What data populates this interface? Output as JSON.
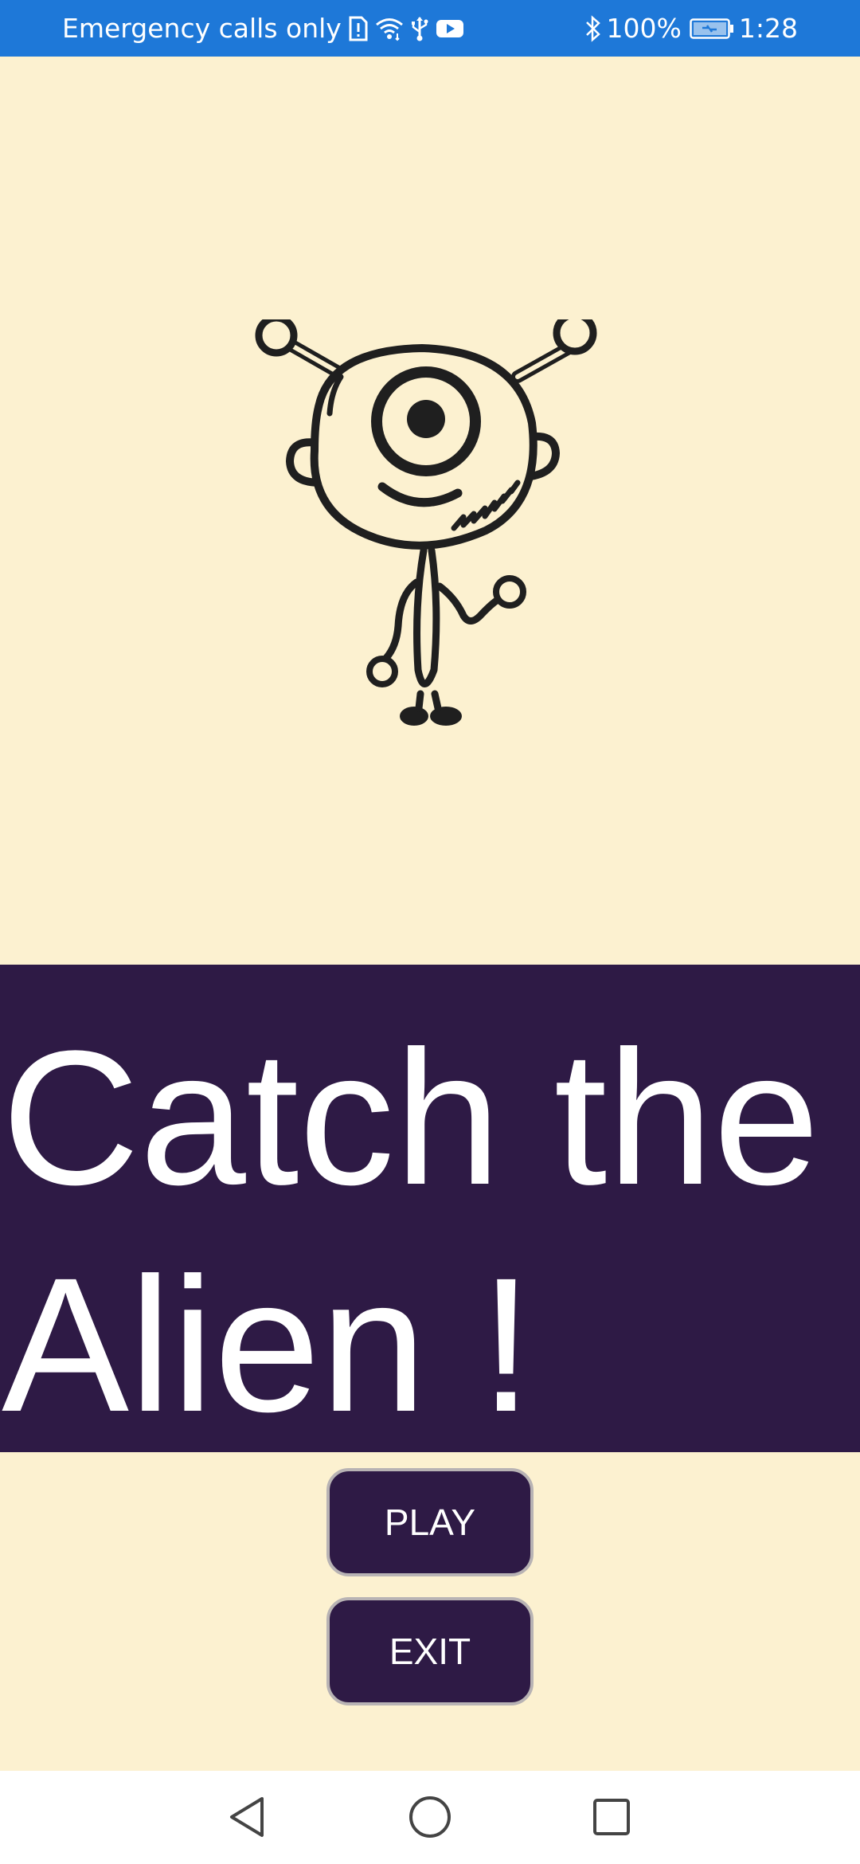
{
  "status_bar": {
    "carrier_text": "Emergency calls only",
    "battery_percent": "100%",
    "time": "1:28",
    "icons": [
      "sim-alert-icon",
      "wifi-icon",
      "usb-icon",
      "youtube-icon",
      "bluetooth-icon",
      "battery-charging-icon"
    ]
  },
  "game": {
    "title": "Catch the Alien !",
    "character": "alien-illustration",
    "play_label": "PLAY",
    "exit_label": "EXIT"
  },
  "colors": {
    "background": "#FCF1D0",
    "banner": "#2E1A45",
    "button_border": "#B8B3B4",
    "status_bar": "#1E78D8"
  },
  "nav_bar": {
    "buttons": [
      "back-icon",
      "home-icon",
      "recent-apps-icon"
    ]
  }
}
